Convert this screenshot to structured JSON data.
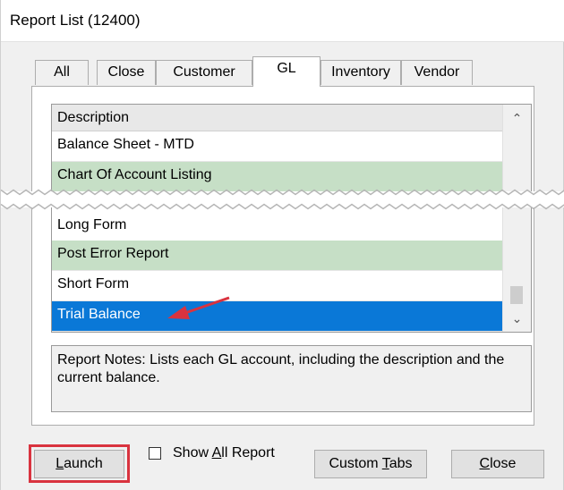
{
  "window": {
    "title": "Report List (12400)"
  },
  "tabs": [
    {
      "label": "All",
      "active": false
    },
    {
      "label": "Close",
      "active": false
    },
    {
      "label": "Customer",
      "active": false
    },
    {
      "label": "GL",
      "active": true
    },
    {
      "label": "Inventory",
      "active": false
    },
    {
      "label": "Vendor",
      "active": false
    }
  ],
  "list": {
    "header": "Description",
    "rows": [
      {
        "label": "Balance Sheet - MTD",
        "style": "white"
      },
      {
        "label": "Chart Of Account Listing",
        "style": "green"
      },
      {
        "label": "Long Form",
        "style": "white"
      },
      {
        "label": "Post Error Report",
        "style": "green"
      },
      {
        "label": "Short Form",
        "style": "white"
      },
      {
        "label": "Trial Balance",
        "style": "selected"
      }
    ]
  },
  "notes": {
    "text": "Report Notes:  Lists each GL account, including the description and the current balance."
  },
  "buttons": {
    "launch_prefix": "",
    "launch_key": "L",
    "launch_rest": "aunch",
    "custom_tabs_prefix": "Custom ",
    "custom_tabs_key": "T",
    "custom_tabs_rest": "abs",
    "close_prefix": "",
    "close_key": "C",
    "close_rest": "lose"
  },
  "show_all": {
    "prefix": "Show ",
    "key": "A",
    "rest": "ll Report",
    "checked": false
  },
  "colors": {
    "selection": "#0a78d7",
    "row_alt": "#c6dfc6",
    "highlight": "#d9333f"
  }
}
